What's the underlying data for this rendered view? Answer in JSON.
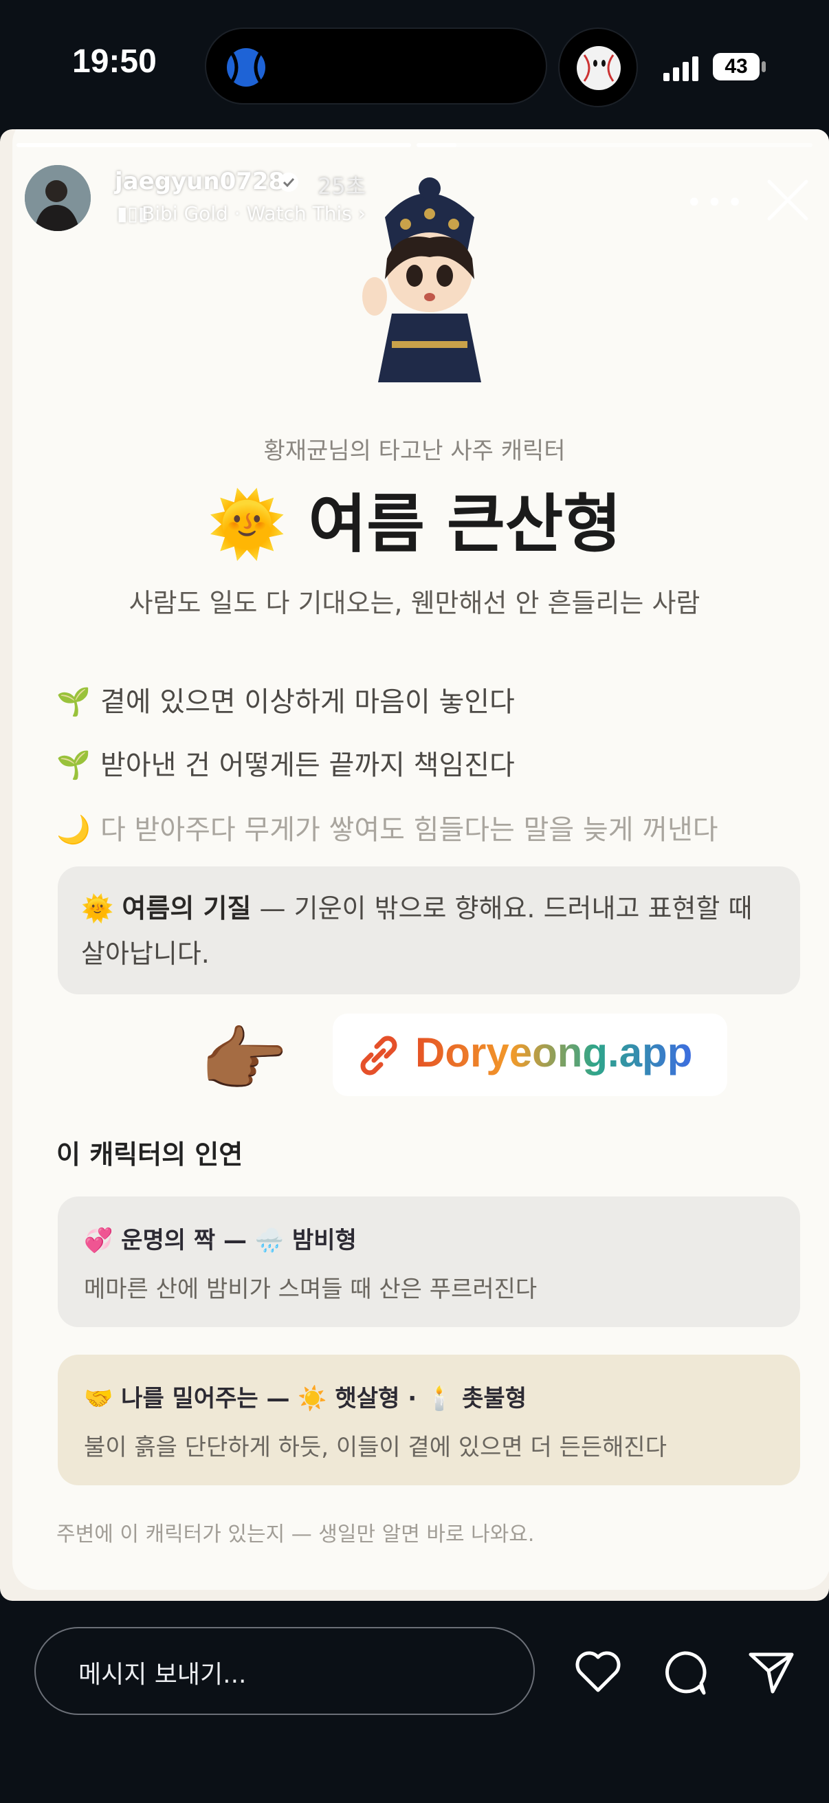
{
  "status_bar": {
    "time": "19:50",
    "battery": "43"
  },
  "story": {
    "username": "jaegyun0728",
    "time_ago": "25초",
    "music": "Bibi Gold · Watch This ›",
    "more": "•••"
  },
  "content": {
    "subtitle": "황재균님의 타고난 사주 캐릭터",
    "title_emoji": "🌞",
    "title": "여름 큰산형",
    "tagline": "사람도 일도 다 기대오는, 웬만해선 안 흔들리는 사람",
    "traits": [
      {
        "icon": "🌱",
        "text": "곁에 있으면 이상하게 마음이 놓인다"
      },
      {
        "icon": "🌱",
        "text": "받아낸 건 어떻게든 끝까지 책임진다"
      },
      {
        "icon": "🌙",
        "text": "다 받아주다 무게가 쌓여도 힘들다는 말을 늦게 꺼낸다"
      }
    ],
    "note_icon": "🌞",
    "note_bold": "여름의 기질",
    "note_text": " — 기운이 밖으로 향해요. 드러내고 표현할 때 살아납니다."
  },
  "sticker": {
    "pointer": "👉🏾",
    "link_text": "Doryeong.app"
  },
  "relations": {
    "section_title": "이 캐릭터의 인연",
    "cards": [
      {
        "head": "💞 운명의 짝 — 🌧️ 밤비형",
        "desc": "메마른 산에 밤비가 스며들 때 산은 푸르러진다"
      },
      {
        "head": "🤝 나를 밀어주는 — ☀️ 햇살형 · 🕯️ 촛불형",
        "desc": "불이 흙을 단단하게 하듯, 이들이 곁에 있으면 더 든든해진다"
      }
    ],
    "footnote": "주변에 이 캐릭터가 있는지 — 생일만 알면 바로 나와요."
  },
  "reply_bar": {
    "placeholder": "메시지 보내기..."
  },
  "colors": {
    "background": "#0b1016",
    "card": "#fbfaf6",
    "accent_gold": "#efe8d6"
  }
}
